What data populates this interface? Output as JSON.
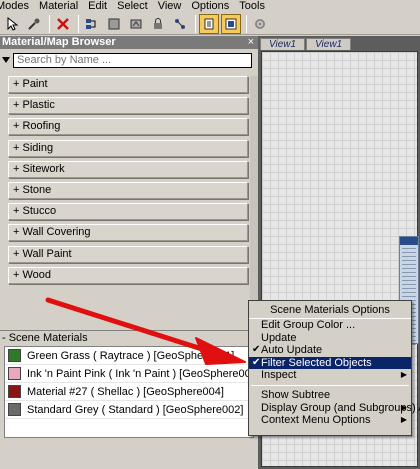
{
  "menu": [
    "Modes",
    "Material",
    "Edit",
    "Select",
    "View",
    "Options",
    "Tools"
  ],
  "toolbar": [
    "select-icon",
    "eyedropper-icon",
    "separator",
    "delete-icon",
    "separator",
    "layout-icon",
    "material-icon",
    "map-icon",
    "lock-icon",
    "separator",
    "highlight-icon",
    "panel-icon",
    "settings-icon"
  ],
  "browser": {
    "title": "Material/Map Browser",
    "close": "×",
    "search_placeholder": "Search by Name ...",
    "libraries": [
      "+ Paint",
      "+ Plastic",
      "+ Roofing",
      "+ Siding",
      "+ Sitework",
      "+ Stone",
      "+ Stucco",
      "+ Wall Covering",
      "+ Wall Paint",
      "+ Wood"
    ],
    "scene_header": "- Scene Materials",
    "scene_materials": [
      {
        "label": "Green Grass  ( Raytrace ) [GeoSphere001]",
        "swatch": "#2f7a2a"
      },
      {
        "label": "Ink 'n Paint Pink  ( Ink 'n Paint ) [GeoSphere003]",
        "swatch": "#e9a7c2"
      },
      {
        "label": "Material #27  ( Shellac ) [GeoSphere004]",
        "swatch": "#8a1414"
      },
      {
        "label": "Standard Grey  ( Standard ) [GeoSphere002]",
        "swatch": "#6a6a6a"
      }
    ]
  },
  "viewports": {
    "tabs": [
      "View1",
      "View1"
    ]
  },
  "context_menu": {
    "title": "Scene Materials Options",
    "items": [
      {
        "label": "Edit Group Color ...",
        "check": "",
        "sub": ""
      },
      {
        "label": "Update",
        "check": "",
        "sub": ""
      },
      {
        "label": "Auto Update",
        "check": "✔",
        "sub": ""
      },
      {
        "label": "Filter Selected Objects",
        "check": "✔",
        "sub": ""
      },
      {
        "label": "Inspect",
        "check": "",
        "sub": "▶"
      },
      {
        "label": "Show Subtree",
        "check": "",
        "sub": ""
      },
      {
        "label": "Display Group (and Subgroups) As",
        "check": "",
        "sub": "▶"
      },
      {
        "label": "Context Menu Options",
        "check": "",
        "sub": "▶"
      }
    ]
  },
  "colors": {
    "highlight": "#0a246a",
    "arrow": "#e01010",
    "active_tool": "#f7c95a"
  }
}
